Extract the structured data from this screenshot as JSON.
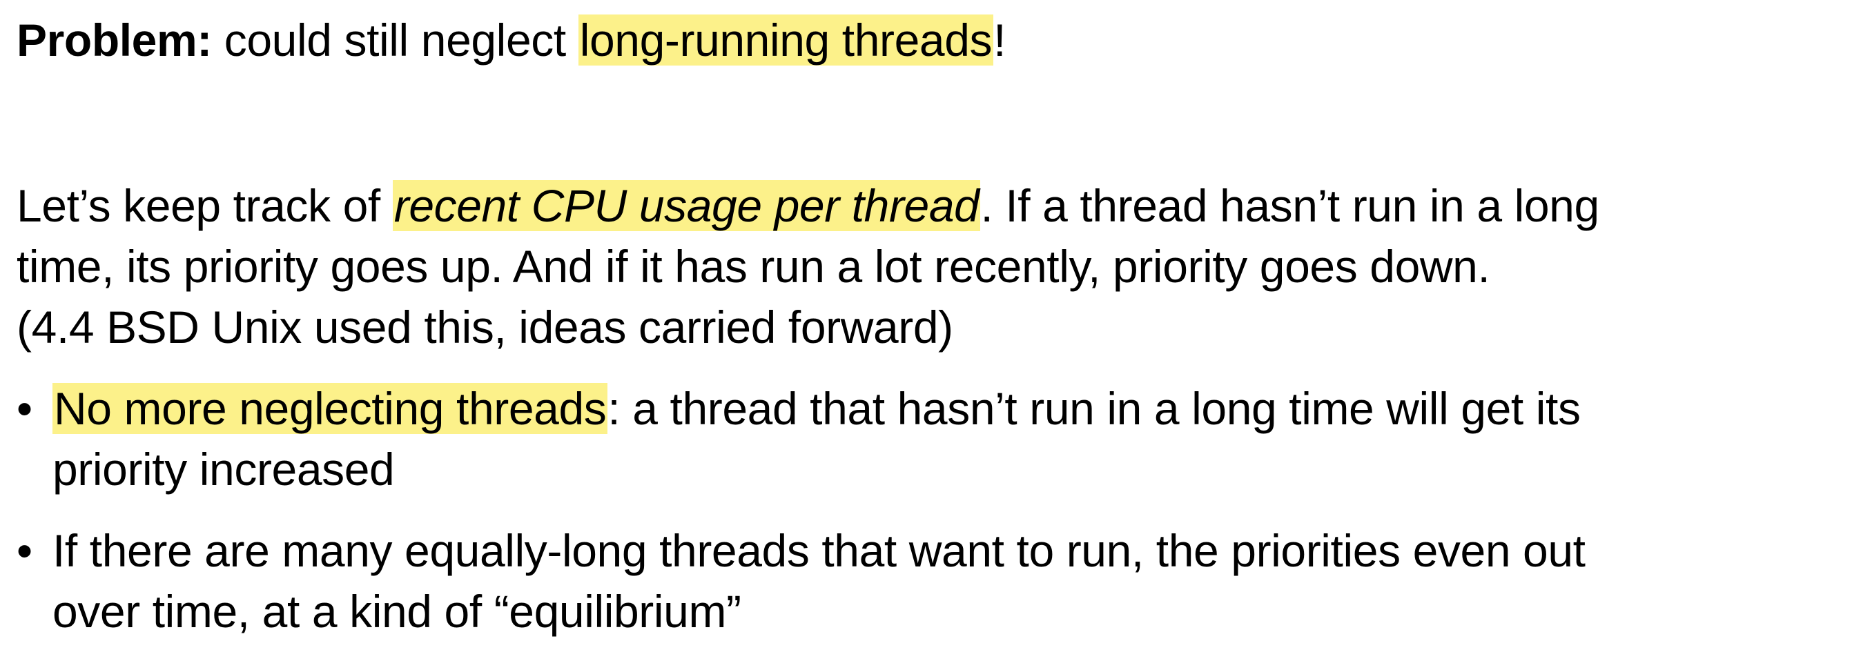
{
  "problem": {
    "label": "Problem:",
    "text_before": " could still neglect ",
    "highlight": "long-running threads",
    "text_after": "!"
  },
  "paragraph": {
    "line1_before": "Let’s keep track of ",
    "line1_highlight": "recent CPU usage per thread",
    "line1_after": ".  If a thread hasn’t run in a long",
    "line2": "time, its priority goes up.  And if it has run a lot recently, priority goes down.",
    "line3": "(4.4 BSD Unix used this, ideas carried forward)"
  },
  "bullets": [
    {
      "marker": "•",
      "highlight": "No more neglecting threads",
      "line1_after": ": a thread that hasn’t run in a long time will get its",
      "line2": "priority increased"
    },
    {
      "marker": "•",
      "line1": "If there are many equally-long threads that want to run, the priorities even out",
      "line2": "over time, at a kind of “equilibrium”"
    }
  ],
  "colors": {
    "highlight": "#fcf18a",
    "text": "#000000"
  }
}
